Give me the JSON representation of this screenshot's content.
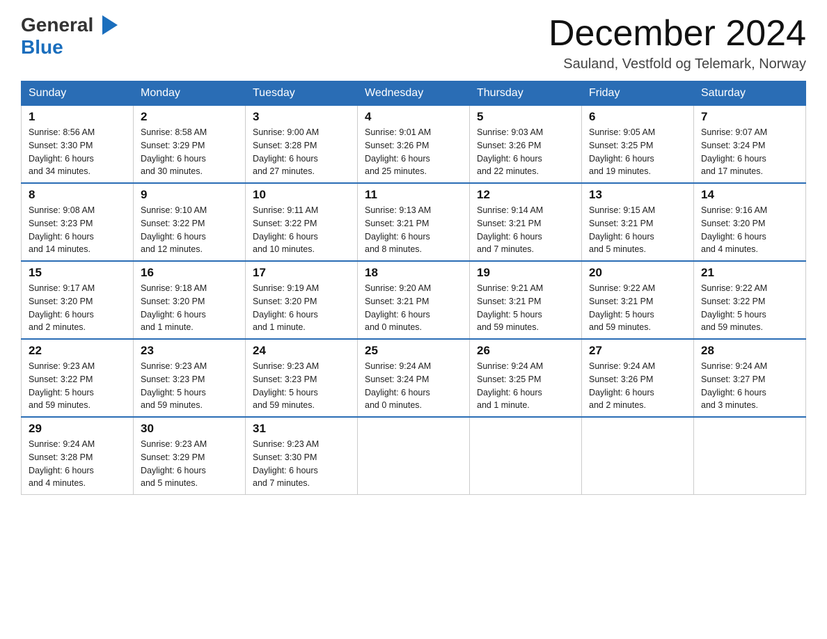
{
  "logo": {
    "text_general": "General",
    "text_blue": "Blue",
    "arrow": "▶"
  },
  "title": "December 2024",
  "subtitle": "Sauland, Vestfold og Telemark, Norway",
  "days_of_week": [
    "Sunday",
    "Monday",
    "Tuesday",
    "Wednesday",
    "Thursday",
    "Friday",
    "Saturday"
  ],
  "weeks": [
    [
      {
        "day": "1",
        "sunrise": "8:56 AM",
        "sunset": "3:30 PM",
        "daylight": "6 hours and 34 minutes."
      },
      {
        "day": "2",
        "sunrise": "8:58 AM",
        "sunset": "3:29 PM",
        "daylight": "6 hours and 30 minutes."
      },
      {
        "day": "3",
        "sunrise": "9:00 AM",
        "sunset": "3:28 PM",
        "daylight": "6 hours and 27 minutes."
      },
      {
        "day": "4",
        "sunrise": "9:01 AM",
        "sunset": "3:26 PM",
        "daylight": "6 hours and 25 minutes."
      },
      {
        "day": "5",
        "sunrise": "9:03 AM",
        "sunset": "3:26 PM",
        "daylight": "6 hours and 22 minutes."
      },
      {
        "day": "6",
        "sunrise": "9:05 AM",
        "sunset": "3:25 PM",
        "daylight": "6 hours and 19 minutes."
      },
      {
        "day": "7",
        "sunrise": "9:07 AM",
        "sunset": "3:24 PM",
        "daylight": "6 hours and 17 minutes."
      }
    ],
    [
      {
        "day": "8",
        "sunrise": "9:08 AM",
        "sunset": "3:23 PM",
        "daylight": "6 hours and 14 minutes."
      },
      {
        "day": "9",
        "sunrise": "9:10 AM",
        "sunset": "3:22 PM",
        "daylight": "6 hours and 12 minutes."
      },
      {
        "day": "10",
        "sunrise": "9:11 AM",
        "sunset": "3:22 PM",
        "daylight": "6 hours and 10 minutes."
      },
      {
        "day": "11",
        "sunrise": "9:13 AM",
        "sunset": "3:21 PM",
        "daylight": "6 hours and 8 minutes."
      },
      {
        "day": "12",
        "sunrise": "9:14 AM",
        "sunset": "3:21 PM",
        "daylight": "6 hours and 7 minutes."
      },
      {
        "day": "13",
        "sunrise": "9:15 AM",
        "sunset": "3:21 PM",
        "daylight": "6 hours and 5 minutes."
      },
      {
        "day": "14",
        "sunrise": "9:16 AM",
        "sunset": "3:20 PM",
        "daylight": "6 hours and 4 minutes."
      }
    ],
    [
      {
        "day": "15",
        "sunrise": "9:17 AM",
        "sunset": "3:20 PM",
        "daylight": "6 hours and 2 minutes."
      },
      {
        "day": "16",
        "sunrise": "9:18 AM",
        "sunset": "3:20 PM",
        "daylight": "6 hours and 1 minute."
      },
      {
        "day": "17",
        "sunrise": "9:19 AM",
        "sunset": "3:20 PM",
        "daylight": "6 hours and 1 minute."
      },
      {
        "day": "18",
        "sunrise": "9:20 AM",
        "sunset": "3:21 PM",
        "daylight": "6 hours and 0 minutes."
      },
      {
        "day": "19",
        "sunrise": "9:21 AM",
        "sunset": "3:21 PM",
        "daylight": "5 hours and 59 minutes."
      },
      {
        "day": "20",
        "sunrise": "9:22 AM",
        "sunset": "3:21 PM",
        "daylight": "5 hours and 59 minutes."
      },
      {
        "day": "21",
        "sunrise": "9:22 AM",
        "sunset": "3:22 PM",
        "daylight": "5 hours and 59 minutes."
      }
    ],
    [
      {
        "day": "22",
        "sunrise": "9:23 AM",
        "sunset": "3:22 PM",
        "daylight": "5 hours and 59 minutes."
      },
      {
        "day": "23",
        "sunrise": "9:23 AM",
        "sunset": "3:23 PM",
        "daylight": "5 hours and 59 minutes."
      },
      {
        "day": "24",
        "sunrise": "9:23 AM",
        "sunset": "3:23 PM",
        "daylight": "5 hours and 59 minutes."
      },
      {
        "day": "25",
        "sunrise": "9:24 AM",
        "sunset": "3:24 PM",
        "daylight": "6 hours and 0 minutes."
      },
      {
        "day": "26",
        "sunrise": "9:24 AM",
        "sunset": "3:25 PM",
        "daylight": "6 hours and 1 minute."
      },
      {
        "day": "27",
        "sunrise": "9:24 AM",
        "sunset": "3:26 PM",
        "daylight": "6 hours and 2 minutes."
      },
      {
        "day": "28",
        "sunrise": "9:24 AM",
        "sunset": "3:27 PM",
        "daylight": "6 hours and 3 minutes."
      }
    ],
    [
      {
        "day": "29",
        "sunrise": "9:24 AM",
        "sunset": "3:28 PM",
        "daylight": "6 hours and 4 minutes."
      },
      {
        "day": "30",
        "sunrise": "9:23 AM",
        "sunset": "3:29 PM",
        "daylight": "6 hours and 5 minutes."
      },
      {
        "day": "31",
        "sunrise": "9:23 AM",
        "sunset": "3:30 PM",
        "daylight": "6 hours and 7 minutes."
      },
      null,
      null,
      null,
      null
    ]
  ],
  "label_sunrise": "Sunrise:",
  "label_sunset": "Sunset:",
  "label_daylight": "Daylight:"
}
